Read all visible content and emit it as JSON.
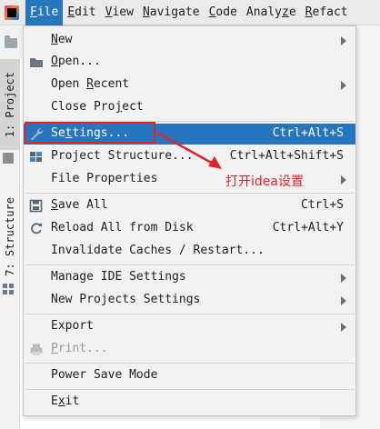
{
  "menubar": {
    "items": [
      {
        "pre": "",
        "mn": "F",
        "post": "ile",
        "active": true
      },
      {
        "pre": "",
        "mn": "E",
        "post": "dit"
      },
      {
        "pre": "",
        "mn": "V",
        "post": "iew"
      },
      {
        "pre": "",
        "mn": "N",
        "post": "avigate"
      },
      {
        "pre": "",
        "mn": "C",
        "post": "ode"
      },
      {
        "pre": "Analy",
        "mn": "z",
        "post": "e"
      },
      {
        "pre": "",
        "mn": "R",
        "post": "efact"
      }
    ]
  },
  "side": {
    "project_tab": "1: Project",
    "structure_tab": "7: Structure"
  },
  "file_menu": {
    "items": [
      {
        "pre": "",
        "mn": "N",
        "post": "ew",
        "shortcut": "",
        "submenu": true
      },
      {
        "pre": "",
        "mn": "O",
        "post": "pen...",
        "shortcut": "",
        "submenu": false,
        "icon": "folder-open-icon"
      },
      {
        "pre": "Open ",
        "mn": "R",
        "post": "ecent",
        "shortcut": "",
        "submenu": true
      },
      {
        "pre": "Close Pro",
        "mn": "j",
        "post": "ect",
        "shortcut": "",
        "submenu": false
      },
      {
        "pre": "Se",
        "mn": "t",
        "post": "tings...",
        "shortcut": "Ctrl+Alt+S",
        "submenu": false,
        "icon": "wrench-icon",
        "selected": true
      },
      {
        "pre": "Project Structure...",
        "mn": "",
        "post": "",
        "shortcut": "Ctrl+Alt+Shift+S",
        "submenu": false,
        "icon": "project-structure-icon"
      },
      {
        "pre": "File Properties",
        "mn": "",
        "post": "",
        "shortcut": "",
        "submenu": true
      },
      {
        "pre": "",
        "mn": "S",
        "post": "ave All",
        "shortcut": "Ctrl+S",
        "submenu": false,
        "icon": "save-icon"
      },
      {
        "pre": "Reload All from Disk",
        "mn": "",
        "post": "",
        "shortcut": "Ctrl+Alt+Y",
        "submenu": false,
        "icon": "reload-icon"
      },
      {
        "pre": "Invalidate Caches / Restart...",
        "mn": "",
        "post": "",
        "shortcut": "",
        "submenu": false
      },
      {
        "pre": "Manage IDE Settings",
        "mn": "",
        "post": "",
        "shortcut": "",
        "submenu": true
      },
      {
        "pre": "New Projects Settings",
        "mn": "",
        "post": "",
        "shortcut": "",
        "submenu": true
      },
      {
        "pre": "Export",
        "mn": "",
        "post": "",
        "shortcut": "",
        "submenu": true
      },
      {
        "pre": "",
        "mn": "P",
        "post": "rint...",
        "shortcut": "",
        "submenu": false,
        "icon": "print-icon",
        "disabled": true
      },
      {
        "pre": "Power Save Mode",
        "mn": "",
        "post": "",
        "shortcut": "",
        "submenu": false
      },
      {
        "pre": "E",
        "mn": "x",
        "post": "it",
        "shortcut": "",
        "submenu": false
      }
    ]
  },
  "annotation": {
    "text": "打开idea设置",
    "color": "#e0262b"
  },
  "colors": {
    "selection": "#2675bf",
    "menu_bg": "#f2f2f2"
  }
}
